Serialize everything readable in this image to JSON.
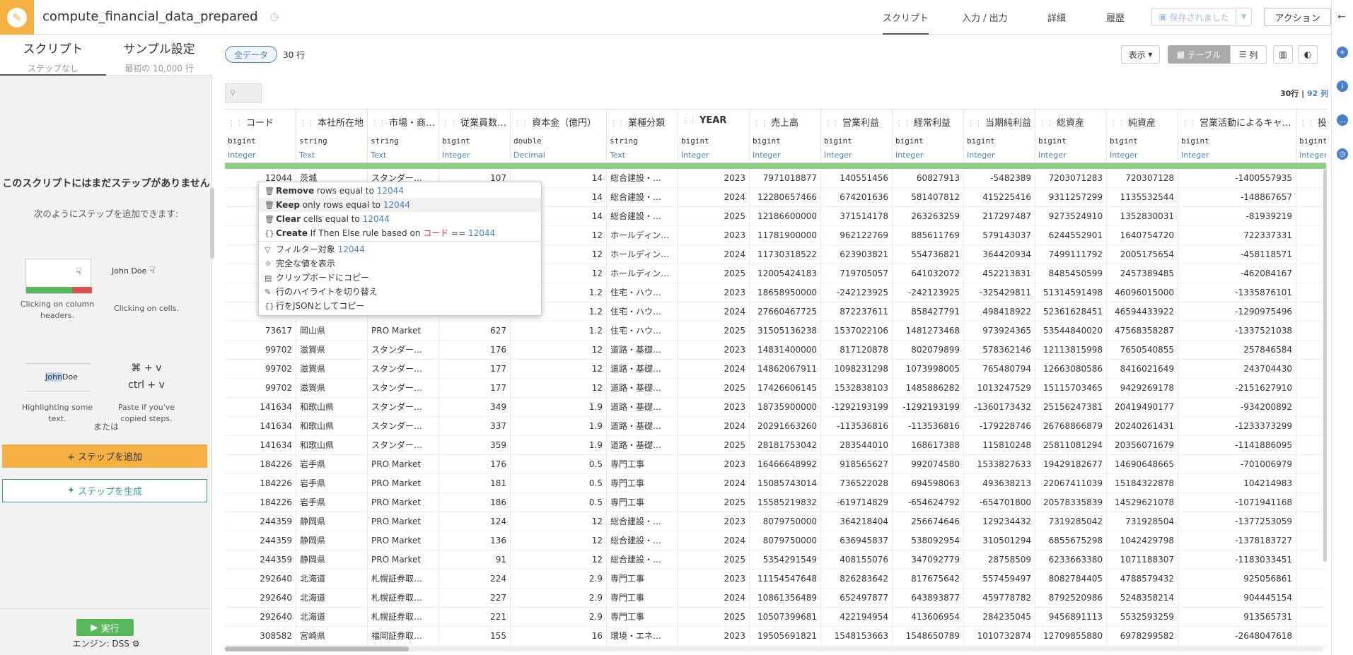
{
  "app": {
    "title": "compute_financial_data_prepared"
  },
  "topnav": {
    "tabs": [
      "スクリプト",
      "入力 / 出力",
      "詳細",
      "履歴"
    ],
    "saved_label": "保存されました",
    "action_label": "アクション"
  },
  "left_panel": {
    "tab_script": "スクリプト",
    "tab_script_sub": "ステップなし",
    "tab_sample": "サンプル設定",
    "tab_sample_sub": "最初の 10,000 行",
    "empty_title": "このスクリプトにはまだステップがありません",
    "empty_sub": "次のようにステップを追加できます:",
    "hint1_caption": "Clicking on column headers.",
    "hint2_caption": "Clicking on cells.",
    "hint2_sample": "John Doe",
    "hint3_caption": "Highlighting some text.",
    "hint3_hl": "John",
    "hint3_rest": "Doe",
    "hint4_keys1": "⌘ + v",
    "hint4_keys2": "ctrl + v",
    "hint4_caption": "Paste if you've copied steps.",
    "or_text": "または",
    "add_step": "+ ステップを追加",
    "gen_step": "ステップを生成",
    "run": "実行",
    "engine": "エンジン: DSS"
  },
  "toolbar": {
    "all_data": "全データ",
    "row_count": "30 行",
    "display": "表示",
    "table": "テーブル",
    "columns": "列",
    "grid_rows": "30行",
    "grid_cols": "92 列"
  },
  "columns": [
    {
      "name": "コード",
      "type": "bigint",
      "meaning": "Integer"
    },
    {
      "name": "本社所在地",
      "type": "string",
      "meaning": "Text"
    },
    {
      "name": "市場・商…",
      "type": "string",
      "meaning": "Text"
    },
    {
      "name": "従業員数…",
      "type": "bigint",
      "meaning": "Integer"
    },
    {
      "name": "資本金（億円）",
      "type": "double",
      "meaning": "Decimal"
    },
    {
      "name": "業種分類",
      "type": "string",
      "meaning": "Text"
    },
    {
      "name": "YEAR",
      "type": "bigint",
      "meaning": "Integer"
    },
    {
      "name": "売上高",
      "type": "bigint",
      "meaning": "Integer"
    },
    {
      "name": "営業利益",
      "type": "bigint",
      "meaning": "Integer"
    },
    {
      "name": "経常利益",
      "type": "bigint",
      "meaning": "Integer"
    },
    {
      "name": "当期純利益",
      "type": "bigint",
      "meaning": "Integer"
    },
    {
      "name": "総資産",
      "type": "bigint",
      "meaning": "Integer"
    },
    {
      "name": "純資産",
      "type": "bigint",
      "meaning": "Integer"
    },
    {
      "name": "営業活動によるキャ…",
      "type": "bigint",
      "meaning": "Integer"
    },
    {
      "name": "投資活動",
      "type": "bigint",
      "meaning": "Integer"
    }
  ],
  "rows": [
    [
      "12044",
      "茨城",
      "スタンダー…",
      "107",
      "14",
      "総合建設・…",
      "2023",
      "7971018877",
      "140551456",
      "60827913",
      "-5482389",
      "7203071283",
      "720307128",
      "-1400557935",
      ""
    ],
    [
      "",
      "",
      "",
      "",
      "14",
      "総合建設・…",
      "2024",
      "12280657466",
      "674201636",
      "581407812",
      "415225416",
      "9311257299",
      "1135532544",
      "-148867657",
      ""
    ],
    [
      "",
      "",
      "",
      "",
      "14",
      "総合建設・…",
      "2025",
      "12186600000",
      "371514178",
      "263263259",
      "217297487",
      "9273524910",
      "1352830031",
      "-81939219",
      ""
    ],
    [
      "",
      "",
      "",
      "",
      "12",
      "ホールディン…",
      "2023",
      "11781900000",
      "962122769",
      "885611769",
      "579143037",
      "6244552901",
      "1640754720",
      "722337331",
      ""
    ],
    [
      "",
      "",
      "",
      "",
      "12",
      "ホールディン…",
      "2024",
      "11730318522",
      "623903821",
      "554736821",
      "364420934",
      "7499111792",
      "2005175654",
      "-458118571",
      ""
    ],
    [
      "",
      "",
      "",
      "",
      "12",
      "ホールディン…",
      "2025",
      "12005424183",
      "719705057",
      "641032072",
      "452213831",
      "8485450599",
      "2457389485",
      "-462084167",
      ""
    ],
    [
      "",
      "",
      "",
      "",
      "1.2",
      "住宅・ハウ…",
      "2023",
      "18658950000",
      "-242123925",
      "-242123925",
      "-325429811",
      "51314591498",
      "46096015000",
      "-1335876101",
      ""
    ],
    [
      "",
      "",
      "",
      "",
      "1.2",
      "住宅・ハウ…",
      "2024",
      "27660467725",
      "872237611",
      "858427791",
      "498418922",
      "52361628451",
      "46594433922",
      "-1290975496",
      ""
    ],
    [
      "73617",
      "岡山県",
      "PRO Market",
      "627",
      "1.2",
      "住宅・ハウ…",
      "2025",
      "31505136238",
      "1537022106",
      "1481273468",
      "973924365",
      "53544840020",
      "47568358287",
      "-1337521038",
      ""
    ],
    [
      "99702",
      "滋賀県",
      "スタンダー…",
      "176",
      "12",
      "道路・基礎…",
      "2023",
      "14831400000",
      "817120878",
      "802079899",
      "578362146",
      "12113815998",
      "7650540855",
      "257846584",
      ""
    ],
    [
      "99702",
      "滋賀県",
      "スタンダー…",
      "177",
      "12",
      "道路・基礎…",
      "2024",
      "14862067911",
      "1098231298",
      "1073998005",
      "765480794",
      "12663080586",
      "8416021649",
      "243704430",
      ""
    ],
    [
      "99702",
      "滋賀県",
      "スタンダー…",
      "177",
      "12",
      "道路・基礎…",
      "2025",
      "17426606145",
      "1532838103",
      "1485886282",
      "1013247529",
      "15115703465",
      "9429269178",
      "-2151627910",
      ""
    ],
    [
      "141634",
      "和歌山県",
      "スタンダー…",
      "349",
      "1.9",
      "道路・基礎…",
      "2023",
      "18735900000",
      "-1292193199",
      "-1292193199",
      "-1360173432",
      "25156247381",
      "20419490177",
      "-934200892",
      ""
    ],
    [
      "141634",
      "和歌山県",
      "スタンダー…",
      "337",
      "1.9",
      "道路・基礎…",
      "2024",
      "20291663260",
      "-113536816",
      "-113536816",
      "-179228746",
      "26768866879",
      "20240261431",
      "-1233373299",
      ""
    ],
    [
      "141634",
      "和歌山県",
      "スタンダー…",
      "359",
      "1.9",
      "道路・基礎…",
      "2025",
      "28181753042",
      "283544010",
      "168617388",
      "115810248",
      "25811081294",
      "20356071679",
      "-1141886095",
      ""
    ],
    [
      "184226",
      "岩手県",
      "PRO Market",
      "176",
      "0.5",
      "専門工事",
      "2023",
      "16466648992",
      "918565627",
      "992074580",
      "1533827633",
      "19429182677",
      "14690648665",
      "-701006979",
      ""
    ],
    [
      "184226",
      "岩手県",
      "PRO Market",
      "181",
      "0.5",
      "専門工事",
      "2024",
      "15085743014",
      "736522028",
      "694598063",
      "493638213",
      "22067411039",
      "15184322878",
      "104214983",
      ""
    ],
    [
      "184226",
      "岩手県",
      "PRO Market",
      "186",
      "0.5",
      "専門工事",
      "2025",
      "15585219832",
      "-619714829",
      "-654624792",
      "-654701800",
      "20578335839",
      "14529621078",
      "-1071941168",
      ""
    ],
    [
      "244359",
      "静岡県",
      "PRO Market",
      "124",
      "12",
      "総合建設・…",
      "2023",
      "8079750000",
      "364218404",
      "256674646",
      "129234432",
      "7319285042",
      "731928504",
      "-1377253059",
      ""
    ],
    [
      "244359",
      "静岡県",
      "PRO Market",
      "136",
      "12",
      "総合建設・…",
      "2024",
      "8079750000",
      "636945837",
      "538092954",
      "310501294",
      "6855675298",
      "1042429798",
      "-1378183727",
      ""
    ],
    [
      "244359",
      "静岡県",
      "PRO Market",
      "91",
      "12",
      "総合建設・…",
      "2025",
      "5354291549",
      "408155076",
      "347092779",
      "28758509",
      "6233663380",
      "1071188307",
      "-1183033451",
      ""
    ],
    [
      "292640",
      "北海道",
      "札幌証券取…",
      "224",
      "2.9",
      "専門工事",
      "2023",
      "11154547648",
      "826283642",
      "817675642",
      "557459497",
      "8082784405",
      "4788579432",
      "925056861",
      ""
    ],
    [
      "292640",
      "北海道",
      "札幌証券取…",
      "227",
      "2.9",
      "専門工事",
      "2024",
      "10861356489",
      "652497877",
      "643893877",
      "459778782",
      "8792520986",
      "5248358214",
      "904445154",
      ""
    ],
    [
      "292640",
      "北海道",
      "札幌証券取…",
      "221",
      "2.9",
      "専門工事",
      "2025",
      "10507399681",
      "422194954",
      "413606954",
      "284235045",
      "9456891113",
      "5532593259",
      "913565731",
      ""
    ],
    [
      "308582",
      "宮崎県",
      "福岡証券取…",
      "155",
      "16",
      "環境・エネ…",
      "2023",
      "19505691821",
      "1548153663",
      "1548650789",
      "1010732874",
      "12709855880",
      "6978299582",
      "-2648047618",
      ""
    ]
  ],
  "context_menu": {
    "value": "12044",
    "col": "コード",
    "remove_b": "Remove",
    "remove_t": " rows equal to ",
    "keep_b": "Keep",
    "keep_t": " only rows equal to ",
    "clear_b": "Clear",
    "clear_t": " cells equal to ",
    "create_b": "Create",
    "create_t": " If Then Else rule based on ",
    "create_op": " == ",
    "filter": "フィルター対象 ",
    "full_value": "完全な値を表示",
    "copy_clip": "クリップボードにコピー",
    "toggle_hl": "行のハイライトを切り替え",
    "copy_json": "行をJSONとしてコピー"
  },
  "colors": {
    "accent": "#f4b043",
    "link": "#4a7fd0",
    "run": "#5bb75b",
    "teal": "#3a9a9a"
  }
}
